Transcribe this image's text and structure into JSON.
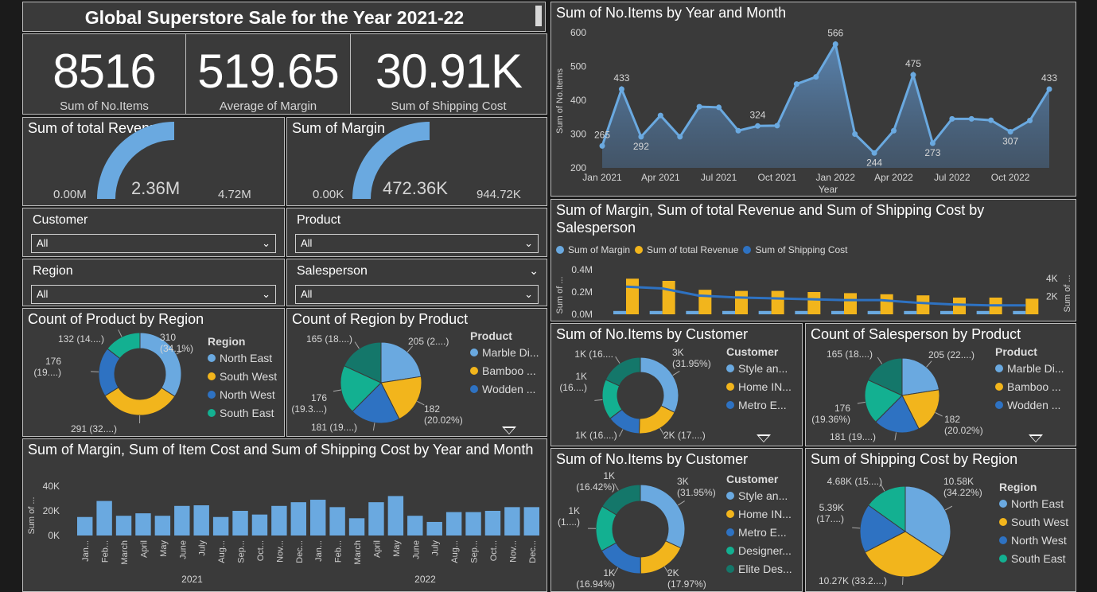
{
  "colors": {
    "c1": "#6aa9e0",
    "c2": "#f2b51c",
    "c3": "#2e72c2",
    "c4": "#13b091",
    "c5": "#14776a"
  },
  "header": {
    "title": "Global Superstore Sale for the Year 2021-22"
  },
  "kpis": [
    {
      "value": "8516",
      "label": "Sum of No.Items"
    },
    {
      "value": "519.65",
      "label": "Average of Margin"
    },
    {
      "value": "30.91K",
      "label": "Sum of Shipping Cost"
    }
  ],
  "gauge_revenue": {
    "title": "Sum of total Revenue",
    "min": "0.00M",
    "value": "2.36M",
    "max": "4.72M",
    "fraction": 0.5
  },
  "gauge_margin": {
    "title": "Sum of Margin",
    "min": "0.00K",
    "value": "472.36K",
    "max": "944.72K",
    "fraction": 0.5
  },
  "slicers": {
    "customer": {
      "label": "Customer",
      "value": "All"
    },
    "product": {
      "label": "Product",
      "value": "All"
    },
    "region": {
      "label": "Region",
      "value": "All"
    },
    "salesperson": {
      "label": "Salesperson",
      "value": "All"
    }
  },
  "donut_region": {
    "title": "Count of Product by Region",
    "legend_title": "Region",
    "legend": [
      "North East",
      "South West",
      "North West",
      "South East"
    ],
    "slices": [
      {
        "name": "North East",
        "value": 310,
        "color": "#6aa9e0",
        "label1": "310",
        "label2": "(34.1%)"
      },
      {
        "name": "South West",
        "value": 291,
        "color": "#f2b51c",
        "label1": "291 (32....)",
        "label2": ""
      },
      {
        "name": "North West",
        "value": 176,
        "color": "#2e72c2",
        "label1": "176",
        "label2": "(19....)"
      },
      {
        "name": "South East",
        "value": 132,
        "color": "#13b091",
        "label1": "132 (14....)",
        "label2": ""
      }
    ]
  },
  "pie_product": {
    "title": "Count of Region by Product",
    "legend_title": "Product",
    "legend": [
      "Marble Di...",
      "Bamboo ...",
      "Wodden ..."
    ],
    "slices": [
      {
        "value": 205,
        "color": "#6aa9e0",
        "label1": "205 (2....)",
        "label2": ""
      },
      {
        "value": 182,
        "color": "#f2b51c",
        "label1": "182",
        "label2": "(20.02%)"
      },
      {
        "value": 181,
        "color": "#2e72c2",
        "label1": "181 (19....)",
        "label2": ""
      },
      {
        "value": 176,
        "color": "#13b091",
        "label1": "176",
        "label2": "(19.3....)"
      },
      {
        "value": 165,
        "color": "#14776a",
        "label1": "165 (18....)",
        "label2": ""
      }
    ]
  },
  "combo_year": {
    "title": "Sum of Margin, Sum of Item Cost and Sum of Shipping Cost by Year and Month"
  },
  "chart_data": [
    {
      "type": "area",
      "title": "Sum of No.Items by Year and Month",
      "xlabel": "Year",
      "ylabel": "Sum of No.Items",
      "ylim": [
        200,
        600
      ],
      "yticks": [
        "600",
        "500",
        "400",
        "300",
        "200"
      ],
      "xticks": [
        "Jan 2021",
        "Apr 2021",
        "Jul 2021",
        "Oct 2021",
        "Jan 2022",
        "Apr 2022",
        "Jul 2022",
        "Oct 2022"
      ],
      "values": [
        265,
        433,
        292,
        355,
        292,
        381,
        379,
        310,
        324,
        325,
        448,
        469,
        566,
        300,
        244,
        310,
        475,
        273,
        345,
        345,
        341,
        307,
        340,
        433
      ],
      "point_labels": {
        "0": "265",
        "1": "433",
        "2": "292",
        "8": "324",
        "12": "566",
        "14": "244",
        "16": "475",
        "17": "273",
        "21": "307",
        "23": "433"
      }
    },
    {
      "type": "bar",
      "title": "Sum of Margin, Sum of total Revenue and Sum of Shipping Cost by Salesperson",
      "legend": [
        "Sum of Margin",
        "Sum of total Revenue",
        "Sum of Shipping Cost"
      ],
      "ylabel_left": "Sum of ...",
      "ylabel_right": "Sum of ...",
      "yticks_left": [
        "0.4M",
        "0.2M",
        "0.0M"
      ],
      "yticks_right": [
        "4K",
        "2K"
      ],
      "margin": [
        0.03,
        0.03,
        0.03,
        0.03,
        0.03,
        0.03,
        0.03,
        0.03,
        0.03,
        0.03,
        0.03,
        0.03
      ],
      "revenue": [
        0.32,
        0.3,
        0.22,
        0.21,
        0.21,
        0.2,
        0.19,
        0.18,
        0.17,
        0.15,
        0.15,
        0.14
      ],
      "shipping": [
        3.1,
        2.9,
        2.1,
        1.9,
        1.8,
        1.7,
        1.6,
        1.6,
        1.3,
        1.1,
        1.0,
        1.0
      ]
    },
    {
      "type": "bar",
      "title": "Sum of Margin, Sum of Item Cost and Sum of Shipping Cost by Year and Month",
      "ylabel": "Sum of ...",
      "yticks": [
        "40K",
        "20K",
        "0K"
      ],
      "ylim": [
        0,
        40000
      ],
      "months": [
        "Jan...",
        "Feb...",
        "March",
        "April",
        "May",
        "June",
        "July",
        "Aug...",
        "Sep...",
        "Oct...",
        "Nov...",
        "Dec...",
        "Jan...",
        "Feb...",
        "March",
        "April",
        "May",
        "June",
        "July",
        "Aug...",
        "Sep...",
        "Oct...",
        "Nov...",
        "Dec..."
      ],
      "years": [
        "2021",
        "2022"
      ],
      "values": [
        15000,
        28000,
        16000,
        18000,
        16000,
        24000,
        24500,
        15000,
        20000,
        17000,
        24000,
        27000,
        29000,
        23000,
        14000,
        27000,
        32000,
        16000,
        11000,
        19000,
        19000,
        20000,
        23000,
        23000
      ]
    }
  ],
  "donut_customer1": {
    "title": "Sum of No.Items by Customer",
    "legend_title": "Customer",
    "legend": [
      "Style an...",
      "Home IN...",
      "Metro E..."
    ],
    "slices": [
      {
        "value": 3.2,
        "color": "#6aa9e0",
        "label1": "3K",
        "label2": "(31.95%)"
      },
      {
        "value": 1.8,
        "color": "#f2b51c",
        "label1": "2K (17....)",
        "label2": ""
      },
      {
        "value": 1.4,
        "color": "#2e72c2",
        "label1": "1K (16....)",
        "label2": ""
      },
      {
        "value": 1.7,
        "color": "#13b091",
        "label1": "1K",
        "label2": "(16....)"
      },
      {
        "value": 1.8,
        "color": "#14776a",
        "label1": "1K (16....",
        "label2": ""
      }
    ]
  },
  "pie_salesperson": {
    "title": "Count of Salesperson by Product",
    "legend_title": "Product",
    "legend": [
      "Marble Di...",
      "Bamboo ...",
      "Wodden ..."
    ],
    "slices": [
      {
        "value": 205,
        "color": "#6aa9e0",
        "label1": "205 (22....)",
        "label2": ""
      },
      {
        "value": 182,
        "color": "#f2b51c",
        "label1": "182",
        "label2": "(20.02%)"
      },
      {
        "value": 181,
        "color": "#2e72c2",
        "label1": "181 (19....)",
        "label2": ""
      },
      {
        "value": 176,
        "color": "#13b091",
        "label1": "176",
        "label2": "(19.36%)"
      },
      {
        "value": 165,
        "color": "#14776a",
        "label1": "165 (18....)",
        "label2": ""
      }
    ]
  },
  "donut_customer2": {
    "title": "Sum of No.Items by Customer",
    "legend_title": "Customer",
    "legend": [
      "Style an...",
      "Home IN...",
      "Metro E...",
      "Designer...",
      "Elite Des..."
    ],
    "slices": [
      {
        "value": 31.95,
        "color": "#6aa9e0",
        "label1": "3K",
        "label2": "(31.95%)"
      },
      {
        "value": 17.97,
        "color": "#f2b51c",
        "label1": "2K",
        "label2": "(17.97%)"
      },
      {
        "value": 16.94,
        "color": "#2e72c2",
        "label1": "1K",
        "label2": "(16.94%)"
      },
      {
        "value": 16.72,
        "color": "#13b091",
        "label1": "1K",
        "label2": "(1....)"
      },
      {
        "value": 16.42,
        "color": "#14776a",
        "label1": "1K",
        "label2": "(16.42%)"
      }
    ]
  },
  "pie_shipping": {
    "title": "Sum of Shipping Cost by Region",
    "legend_title": "Region",
    "legend": [
      "North East",
      "South West",
      "North West",
      "South East"
    ],
    "slices": [
      {
        "value": 10.58,
        "color": "#6aa9e0",
        "label1": "10.58K",
        "label2": "(34.22%)"
      },
      {
        "value": 10.27,
        "color": "#f2b51c",
        "label1": "10.27K (33.2....)",
        "label2": ""
      },
      {
        "value": 5.39,
        "color": "#2e72c2",
        "label1": "5.39K",
        "label2": "(17....)"
      },
      {
        "value": 4.68,
        "color": "#13b091",
        "label1": "4.68K (15....)",
        "label2": ""
      }
    ]
  }
}
